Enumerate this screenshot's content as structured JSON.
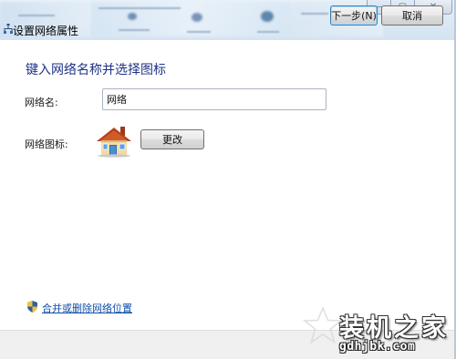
{
  "window": {
    "title": "设置网络属性",
    "caption_buttons": {
      "minimize_glyph": "—",
      "maximize_glyph": "▢",
      "close_glyph": "✕"
    }
  },
  "content": {
    "heading": "键入网络名称并选择图标",
    "network_name_label": "网络名:",
    "network_name_value": "网络",
    "network_icon_label": "网络图标:",
    "change_button_label": "更改",
    "merge_link_label": "合并或删除网络位置"
  },
  "footer": {
    "next_button_label": "下一步(N)",
    "cancel_button_label": "取消"
  },
  "watermark": {
    "brand": "装机之家",
    "url": "gdhjbk.com"
  },
  "icons": {
    "titlebar": "network-icon",
    "house": "house-icon",
    "shield": "uac-shield-icon",
    "star": "star-icon"
  },
  "colors": {
    "heading": "#1e3287",
    "link": "#0f4fa8",
    "titlebar": "#dbe8f4",
    "footer": "#f0f0f0"
  }
}
